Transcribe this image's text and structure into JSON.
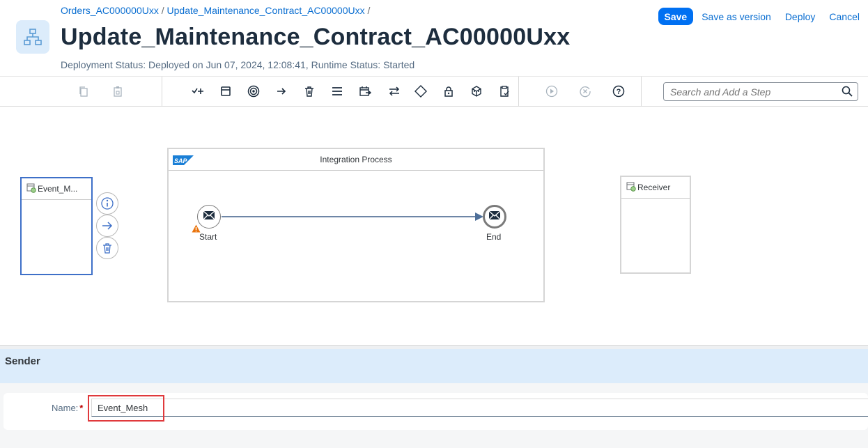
{
  "header": {
    "breadcrumb": [
      {
        "label": "Orders_AC000000Uxx"
      },
      {
        "label": "Update_Maintenance_Contract_AC00000Uxx"
      }
    ],
    "breadcrumb_separator": "/",
    "title": "Update_Maintenance_Contract_AC00000Uxx",
    "deployment_status": "Deployment Status: Deployed on Jun 07, 2024, 12:08:41, Runtime Status: Started",
    "actions": {
      "save": "Save",
      "save_as_version": "Save as version",
      "deploy": "Deploy",
      "cancel": "Cancel"
    }
  },
  "toolbar": {
    "icons": [
      "copy-icon",
      "paste-icon",
      "add-step-icon",
      "participant-icon",
      "process-icon",
      "arrow-connector-icon",
      "delete-icon",
      "menu-icon",
      "event-icon",
      "exchange-icon",
      "gateway-icon",
      "lock-icon",
      "cube-icon",
      "clipboard-check-icon",
      "run-icon",
      "cancel-run-icon",
      "help-icon"
    ],
    "search": {
      "placeholder": "Search and Add a Step",
      "value": ""
    }
  },
  "canvas": {
    "sender": {
      "label": "Event_M..."
    },
    "receiver": {
      "label": "Receiver"
    },
    "process": {
      "title": "Integration Process",
      "logo": "SAP",
      "start_label": "Start",
      "end_label": "End"
    }
  },
  "properties": {
    "title": "Sender",
    "name_label": "Name:",
    "required_marker": "*",
    "name_value": "Event_Mesh"
  },
  "colors": {
    "primary": "#0070f2",
    "link": "#0a6ed1",
    "selection": "#3e70c8",
    "panel_header": "#dcecfb",
    "warning": "#e9730c",
    "highlight": "#e0393c"
  }
}
